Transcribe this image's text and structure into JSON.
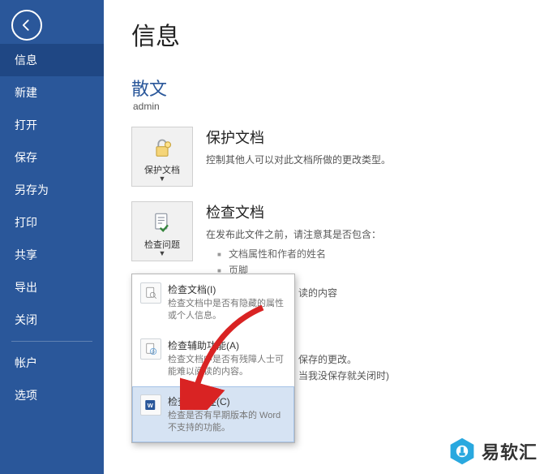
{
  "sidebar": {
    "items": [
      {
        "label": "信息",
        "active": true
      },
      {
        "label": "新建"
      },
      {
        "label": "打开"
      },
      {
        "label": "保存"
      },
      {
        "label": "另存为"
      },
      {
        "label": "打印"
      },
      {
        "label": "共享"
      },
      {
        "label": "导出"
      },
      {
        "label": "关闭"
      }
    ],
    "bottom": [
      {
        "label": "帐户"
      },
      {
        "label": "选项"
      }
    ]
  },
  "page": {
    "title": "信息",
    "doc_title": "散文",
    "doc_path": "admin"
  },
  "protect": {
    "tile_label": "保护文档",
    "heading": "保护文档",
    "desc": "控制其他人可以对此文档所做的更改类型。"
  },
  "inspect": {
    "tile_label": "检查问题",
    "heading": "检查文档",
    "desc": "在发布此文件之前，请注意其是否包含：",
    "items": [
      "文档属性和作者的姓名",
      "页脚"
    ],
    "overflow1": "读的内容",
    "overflow2": "保存的更改。",
    "overflow3": "当我没保存就关闭时)"
  },
  "dropdown": {
    "items": [
      {
        "title": "检查文档(I)",
        "desc": "检查文档中是否有隐藏的属性或个人信息。",
        "icon": "doc-search"
      },
      {
        "title": "检查辅助功能(A)",
        "desc": "检查文档中是否有残障人士可能难以阅读的内容。",
        "icon": "doc-person"
      },
      {
        "title": "检查兼容性(C)",
        "desc": "检查是否有早期版本的 Word 不支持的功能。",
        "icon": "word-compat",
        "highlight": true
      }
    ]
  },
  "watermark": {
    "text": "易软汇"
  }
}
